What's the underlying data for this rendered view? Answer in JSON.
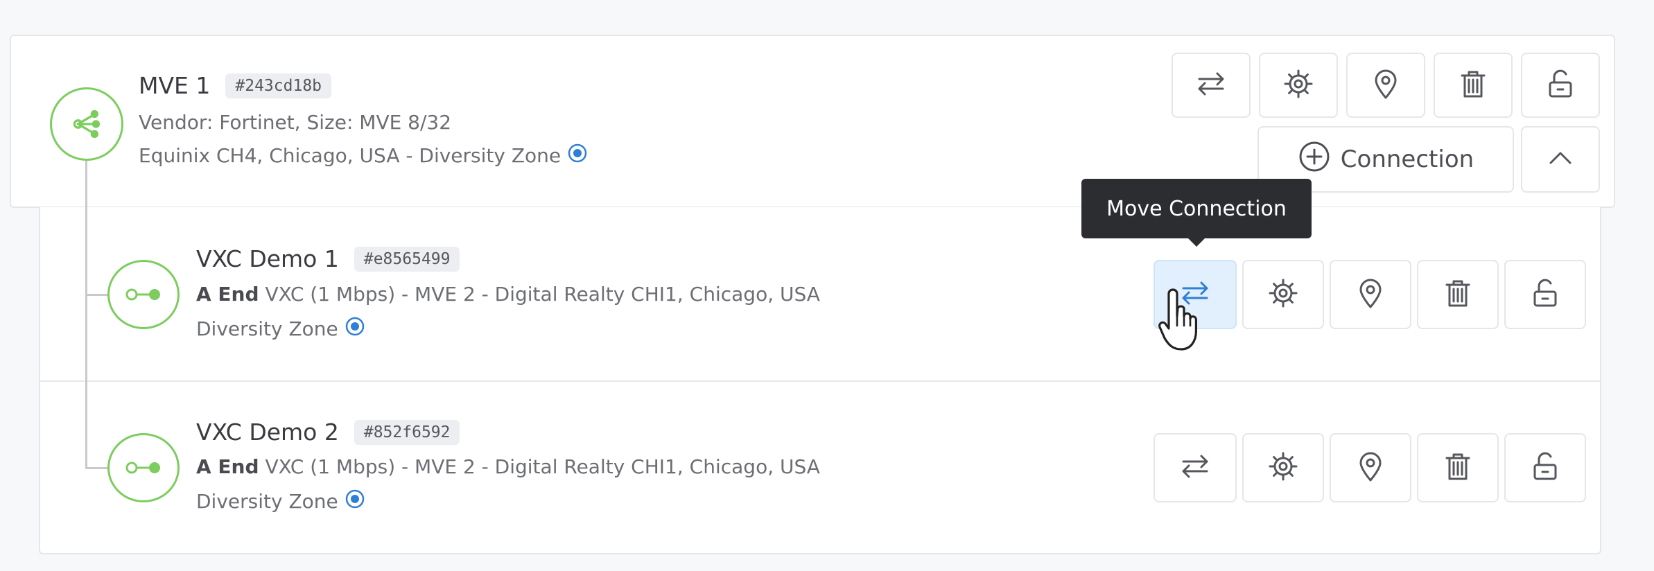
{
  "mve": {
    "name": "MVE 1",
    "tag": "#243cd18b",
    "line1": "Vendor: Fortinet, Size: MVE 8/32",
    "line2": "Equinix CH4, Chicago, USA - Diversity Zone",
    "connection_button_label": "Connection",
    "icon": "share-nodes-icon"
  },
  "tooltip": {
    "text": "Move Connection"
  },
  "connections": [
    {
      "name": "VXC Demo 1",
      "tag": "#e8565499",
      "end_label": "A End",
      "detail": "VXC (1 Mbps) - MVE 2 - Digital Realty CHI1, Chicago, USA",
      "zone": "Diversity Zone",
      "icon": "vxc-connector-icon"
    },
    {
      "name": "VXC Demo 2",
      "tag": "#852f6592",
      "end_label": "A End",
      "detail": "VXC (1 Mbps) - MVE 2 - Digital Realty CHI1, Chicago, USA",
      "zone": "Diversity Zone",
      "icon": "vxc-connector-icon"
    }
  ],
  "actions": [
    "move-icon",
    "gear-icon",
    "location-pin-icon",
    "trash-icon",
    "unlock-icon"
  ],
  "colors": {
    "node_green": "#7ccd5e",
    "accent_blue": "#2f7fd6",
    "tooltip_bg": "#2b2d31",
    "hover_bg": "#e1f0fc"
  }
}
